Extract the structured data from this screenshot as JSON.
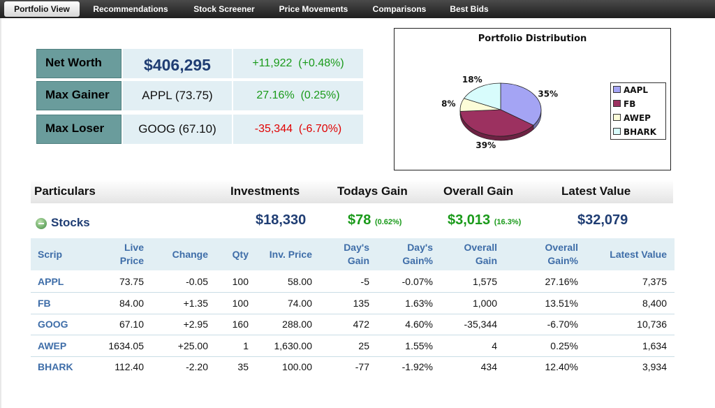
{
  "nav": {
    "tabs": [
      {
        "label": "Portfolio View",
        "active": true
      },
      {
        "label": "Recommendations",
        "active": false
      },
      {
        "label": "Stock Screener",
        "active": false
      },
      {
        "label": "Price Movements",
        "active": false
      },
      {
        "label": "Comparisons",
        "active": false
      },
      {
        "label": "Best Bids",
        "active": false
      }
    ]
  },
  "summary": {
    "net_worth": {
      "label": "Net Worth",
      "value": "$406,295",
      "change": "+11,922",
      "change_pct": "(+0.48%)"
    },
    "max_gainer": {
      "label": "Max Gainer",
      "value": "APPL (73.75)",
      "change": "27.16%",
      "change_pct": "(0.25%)"
    },
    "max_loser": {
      "label": "Max Loser",
      "value": "GOOG (67.10)",
      "change": "-35,344",
      "change_pct": "(-6.70%)"
    }
  },
  "chart_data": {
    "type": "pie",
    "title": "Portfolio Distribution",
    "categories": [
      "AAPL",
      "FB",
      "AWEP",
      "BHARK"
    ],
    "values": [
      35,
      39,
      8,
      18
    ],
    "labels": [
      "35%",
      "39%",
      "8%",
      "18%"
    ],
    "colors": [
      "#a4a4f4",
      "#9c3160",
      "#fcfcd8",
      "#d8fcfc"
    ],
    "legend_position": "right"
  },
  "table": {
    "headers": {
      "particulars": "Particulars",
      "investments": "Investments",
      "todays_gain": "Todays Gain",
      "overall_gain": "Overall Gain",
      "latest_value": "Latest Value"
    },
    "stocks": {
      "label": "Stocks",
      "investments": "$18,330",
      "todays_gain": "$78",
      "todays_gain_pct": "(0.62%)",
      "overall_gain": "$3,013",
      "overall_gain_pct": "(16.3%)",
      "latest_value": "$32,079"
    },
    "columns": {
      "scrip": "Scrip",
      "live_price_1": "Live",
      "live_price_2": "Price",
      "change": "Change",
      "qty": "Qty",
      "inv_price": "Inv. Price",
      "days_gain_1": "Day's",
      "days_gain_2": "Gain",
      "days_gain_pct_1": "Day's",
      "days_gain_pct_2": "Gain%",
      "overall_gain_1": "Overall",
      "overall_gain_2": "Gain",
      "overall_gain_pct_1": "Overall",
      "overall_gain_pct_2": "Gain%",
      "latest_value": "Latest Value"
    },
    "rows": [
      {
        "scrip": "APPL",
        "live_price": "73.75",
        "change": "-0.05",
        "qty": "100",
        "inv_price": "58.00",
        "days_gain": "-5",
        "days_gain_pct": "-0.07%",
        "overall_gain": "1,575",
        "overall_gain_pct": "27.16%",
        "latest_value": "7,375"
      },
      {
        "scrip": "FB",
        "live_price": "84.00",
        "change": "+1.35",
        "qty": "100",
        "inv_price": "74.00",
        "days_gain": "135",
        "days_gain_pct": "1.63%",
        "overall_gain": "1,000",
        "overall_gain_pct": "13.51%",
        "latest_value": "8,400"
      },
      {
        "scrip": "GOOG",
        "live_price": "67.10",
        "change": "+2.95",
        "qty": "160",
        "inv_price": "288.00",
        "days_gain": "472",
        "days_gain_pct": "4.60%",
        "overall_gain": "-35,344",
        "overall_gain_pct": "-6.70%",
        "latest_value": "10,736"
      },
      {
        "scrip": "AWEP",
        "live_price": "1634.05",
        "change": "+25.00",
        "qty": "1",
        "inv_price": "1,630.00",
        "days_gain": "25",
        "days_gain_pct": "1.55%",
        "overall_gain": "4",
        "overall_gain_pct": "0.25%",
        "latest_value": "1,634"
      },
      {
        "scrip": "BHARK",
        "live_price": "112.40",
        "change": "-2.20",
        "qty": "35",
        "inv_price": "100.00",
        "days_gain": "-77",
        "days_gain_pct": "-1.92%",
        "overall_gain": "434",
        "overall_gain_pct": "12.40%",
        "latest_value": "3,934"
      }
    ]
  }
}
